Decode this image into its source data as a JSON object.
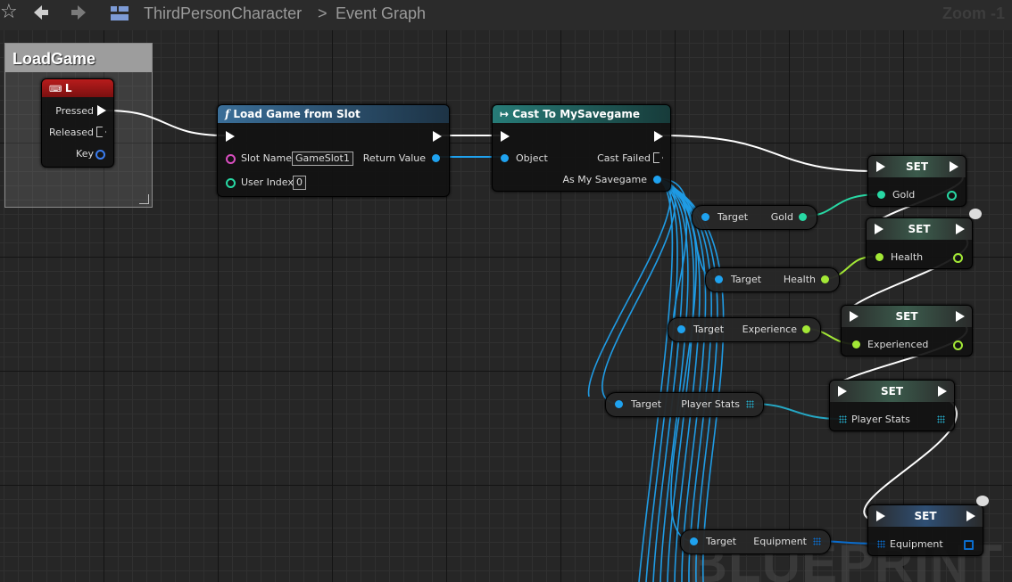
{
  "toolbar": {
    "star_icon": "star-icon",
    "back_icon": "arrow-left-icon",
    "forward_icon": "arrow-right-icon",
    "graph_icon": "graph-icon",
    "breadcrumb_blueprint": "ThirdPersonCharacter",
    "breadcrumb_separator": ">",
    "breadcrumb_graph": "Event Graph",
    "zoom": "Zoom -1"
  },
  "watermark": "BLUEPRINT",
  "comment": {
    "title": "LoadGame"
  },
  "key_event": {
    "title": "L",
    "pins": {
      "pressed": "Pressed",
      "released": "Released",
      "key": "Key"
    }
  },
  "load_game_node": {
    "title": "Load Game from Slot",
    "function_icon": "f",
    "slot_name_label": "Slot Name",
    "slot_name_value": "GameSlot1",
    "user_index_label": "User Index",
    "user_index_value": "0",
    "return_value_label": "Return Value"
  },
  "cast_node": {
    "title": "Cast To MySavegame",
    "object_label": "Object",
    "cast_failed_label": "Cast Failed",
    "as_label": "As My Savegame"
  },
  "get_nodes": [
    {
      "target": "Target",
      "var": "Gold"
    },
    {
      "target": "Target",
      "var": "Health"
    },
    {
      "target": "Target",
      "var": "Experience"
    },
    {
      "target": "Target",
      "var": "Player Stats"
    },
    {
      "target": "Target",
      "var": "Equipment"
    }
  ],
  "set_nodes": [
    {
      "title": "SET",
      "var": "Gold"
    },
    {
      "title": "SET",
      "var": "Health"
    },
    {
      "title": "SET",
      "var": "Experienced"
    },
    {
      "title": "SET",
      "var": "Player Stats"
    },
    {
      "title": "SET",
      "var": "Equipment"
    }
  ],
  "colors": {
    "exec": "#ffffff",
    "object_pin": "#1fa2ef",
    "int_pin": "#28d8a4",
    "float_pin": "#a3e836",
    "struct_pin": "#25a7c4",
    "array_pin": "#0a6ccc",
    "string_pin": "#d94ec0",
    "key_event_header": "#a01818",
    "function_header": "#2d5c7f",
    "cast_header": "#1f6a66"
  }
}
